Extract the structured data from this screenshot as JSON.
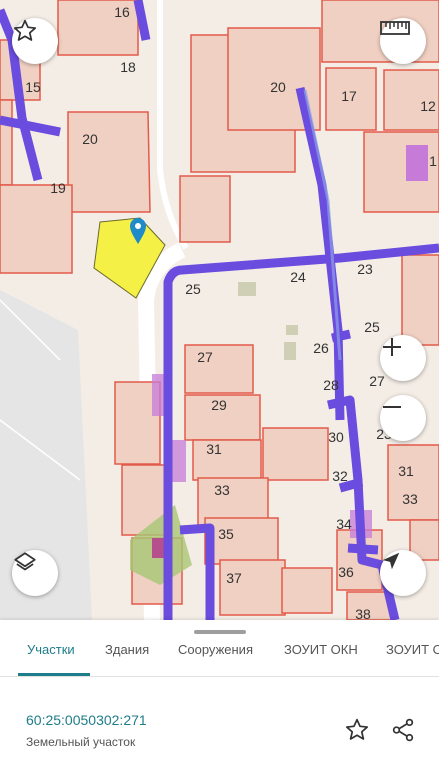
{
  "map": {
    "parcel_numbers": [
      {
        "id": "16",
        "text": "16"
      },
      {
        "id": "15",
        "text": "15"
      },
      {
        "id": "18",
        "text": "18"
      },
      {
        "id": "20a",
        "text": "20"
      },
      {
        "id": "19",
        "text": "19"
      },
      {
        "id": "20b",
        "text": "20"
      },
      {
        "id": "17",
        "text": "17"
      },
      {
        "id": "12",
        "text": "12"
      },
      {
        "id": "1",
        "text": "1"
      },
      {
        "id": "25a",
        "text": "25"
      },
      {
        "id": "24",
        "text": "24"
      },
      {
        "id": "23a",
        "text": "23"
      },
      {
        "id": "25b",
        "text": "25"
      },
      {
        "id": "27a",
        "text": "27"
      },
      {
        "id": "26",
        "text": "26"
      },
      {
        "id": "28",
        "text": "28"
      },
      {
        "id": "27b",
        "text": "27"
      },
      {
        "id": "29",
        "text": "29"
      },
      {
        "id": "23b",
        "text": "23"
      },
      {
        "id": "30",
        "text": "30"
      },
      {
        "id": "31a",
        "text": "31"
      },
      {
        "id": "31b",
        "text": "31"
      },
      {
        "id": "32",
        "text": "32"
      },
      {
        "id": "33a",
        "text": "33"
      },
      {
        "id": "33b",
        "text": "33"
      },
      {
        "id": "34",
        "text": "34"
      },
      {
        "id": "35",
        "text": "35"
      },
      {
        "id": "36",
        "text": "36"
      },
      {
        "id": "37",
        "text": "37"
      },
      {
        "id": "38",
        "text": "38"
      }
    ],
    "colors": {
      "background": "#f4ede6",
      "parcel_fill": "#f0d0c2",
      "parcel_border": "#e35a4a",
      "network_line": "#6a4cde",
      "selected_parcel": "#f5f046",
      "marker": "#1f8bc9",
      "building": "#c77bd8"
    },
    "buttons": {
      "favorite": "star-icon",
      "measure": "ruler-icon",
      "zoom_in": "plus-icon",
      "zoom_out": "minus-icon",
      "layers": "layers-icon",
      "locate": "navigation-arrow-icon"
    }
  },
  "tabs": {
    "items": [
      {
        "label": "Участки",
        "active": true
      },
      {
        "label": "Здания",
        "active": false
      },
      {
        "label": "Сооружения",
        "active": false
      },
      {
        "label": "ЗОУИТ ОКН",
        "active": false
      },
      {
        "label": "ЗОУИТ О",
        "active": false
      }
    ]
  },
  "info": {
    "cadastral_number": "60:25:0050302:271",
    "object_type": "Земельный участок",
    "actions": [
      "star-icon",
      "share-icon"
    ],
    "accent_color": "#1e7d8a"
  }
}
